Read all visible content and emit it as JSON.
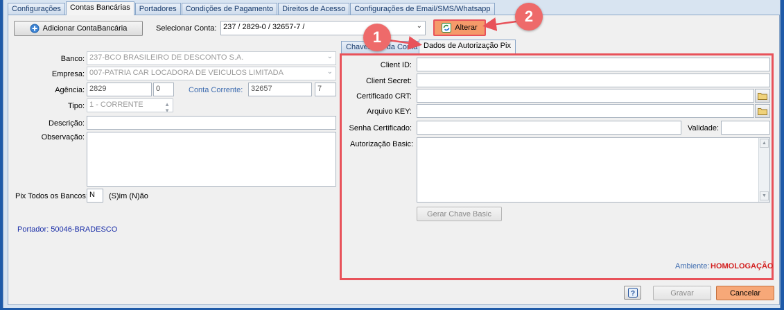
{
  "tabs": [
    {
      "label": "Configurações"
    },
    {
      "label": "Contas Bancárias"
    },
    {
      "label": "Portadores"
    },
    {
      "label": "Condições de Pagamento"
    },
    {
      "label": "Direitos de Acesso"
    },
    {
      "label": "Configurações de Email/SMS/Whatsapp"
    }
  ],
  "active_tab": "Contas Bancárias",
  "toolbar": {
    "add_button_label": "Adicionar ContaBancária",
    "select_account_label": "Selecionar Conta:",
    "select_account_value": "237 / 2829-0 / 32657-7 /",
    "alter_button_label": "Alterar"
  },
  "form": {
    "banco_label": "Banco:",
    "banco_value": "237-BCO BRASILEIRO DE DESCONTO S.A.",
    "empresa_label": "Empresa:",
    "empresa_value": "007-PATRIA CAR LOCADORA DE VEICULOS LIMITADA",
    "agencia_label": "Agência:",
    "agencia_value": "2829",
    "agencia_digit": "0",
    "conta_label": "Conta Corrente:",
    "conta_value": "32657",
    "conta_digit": "7",
    "tipo_label": "Tipo:",
    "tipo_value": "1 - CORRENTE",
    "descricao_label": "Descrição:",
    "descricao_value": "",
    "observacao_label": "Observação:",
    "observacao_value": "",
    "pix_label": "Pix Todos os Bancos:",
    "pix_value": "N",
    "pix_hint": "(S)im (N)ão",
    "portador_text": "Portador: 50046-BRADESCO"
  },
  "subtabs": [
    {
      "label": "Chaves Pix da Conta"
    },
    {
      "label": "Dados de Autorização Pix"
    }
  ],
  "pix": {
    "client_id_label": "Client ID:",
    "client_id_value": "",
    "client_secret_label": "Client Secret:",
    "client_secret_value": "",
    "certificado_label": "Certificado CRT:",
    "certificado_value": "",
    "arquivo_key_label": "Arquivo KEY:",
    "arquivo_key_value": "",
    "senha_label": "Senha Certificado:",
    "senha_value": "",
    "validade_label": "Validade:",
    "validade_value": "",
    "autorizacao_label": "Autorização Basic:",
    "autorizacao_value": "",
    "gerar_button_label": "Gerar Chave Basic",
    "ambiente_label": "Ambiente:",
    "ambiente_value": "HOMOLOGAÇÃO"
  },
  "footer": {
    "help_button_label": "?",
    "gravar_label": "Gravar",
    "cancelar_label": "Cancelar"
  },
  "callouts": [
    "1",
    "2"
  ],
  "colors": {
    "highlight": "#e8525a",
    "callout": "#ee6a6a",
    "ambiente": "#d21f1f",
    "portador": "#1b2fa8",
    "cancel": "#f7a878",
    "alter": "#f59a6a"
  }
}
